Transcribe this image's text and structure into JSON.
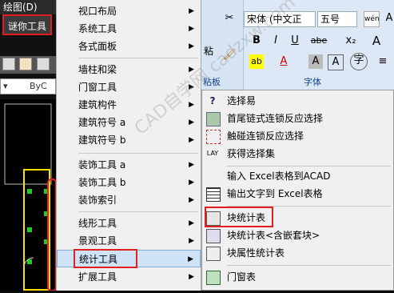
{
  "cad": {
    "title": "绘图(D)",
    "tab_label": "谜你工具",
    "layer_combo": "ByC"
  },
  "menu1": {
    "items": [
      {
        "label": "视口布局",
        "arrow": true
      },
      {
        "label": "系统工具",
        "arrow": true
      },
      {
        "label": "各式面板",
        "arrow": true
      },
      {
        "label": "墙柱和梁",
        "arrow": true
      },
      {
        "label": "门窗工具",
        "arrow": true
      },
      {
        "label": "建筑构件",
        "arrow": true
      },
      {
        "label": "建筑符号 a",
        "arrow": true
      },
      {
        "label": "建筑符号 b",
        "arrow": true
      },
      {
        "label": "装饰工具 a",
        "arrow": true
      },
      {
        "label": "装饰工具 b",
        "arrow": true
      },
      {
        "label": "装饰索引",
        "arrow": true
      },
      {
        "label": "线形工具",
        "arrow": true
      },
      {
        "label": "景观工具",
        "arrow": true
      },
      {
        "label": "统计工具",
        "arrow": true
      },
      {
        "label": "扩展工具",
        "arrow": true
      }
    ]
  },
  "ribbon": {
    "font_name": "宋体 (中文正",
    "font_size": "五号",
    "paste_label": "粘",
    "clipboard_group": "粘板",
    "font_group": "字体",
    "bold": "B",
    "italic": "I",
    "underline": "U",
    "strike": "abe",
    "grow_font": "A",
    "cut_icon": "✂"
  },
  "menu2": {
    "items": [
      {
        "label": "选择易",
        "icon": "question-icon"
      },
      {
        "label": "首尾链式连锁反应选择",
        "icon": "chain-select-icon"
      },
      {
        "label": "触碰连锁反应选择",
        "icon": "touch-select-icon"
      },
      {
        "label": "获得选择集",
        "icon": "selection-set-icon"
      },
      {
        "label": "输入 Excel表格到ACAD",
        "icon": "none"
      },
      {
        "label": "输出文字到 Excel表格",
        "icon": "excel-export-icon"
      },
      {
        "label": "块统计表",
        "icon": "block-stats-icon"
      },
      {
        "label": "块统计表<含嵌套块>",
        "icon": "nested-block-icon"
      },
      {
        "label": "块属性统计表",
        "icon": "block-attr-icon"
      },
      {
        "label": "门窗表",
        "icon": "door-window-icon"
      }
    ]
  },
  "watermark": "CAD自学网 cadzxw.com",
  "colors": {
    "highlight_box": "#e02020",
    "hover": "#cfe3f7"
  }
}
